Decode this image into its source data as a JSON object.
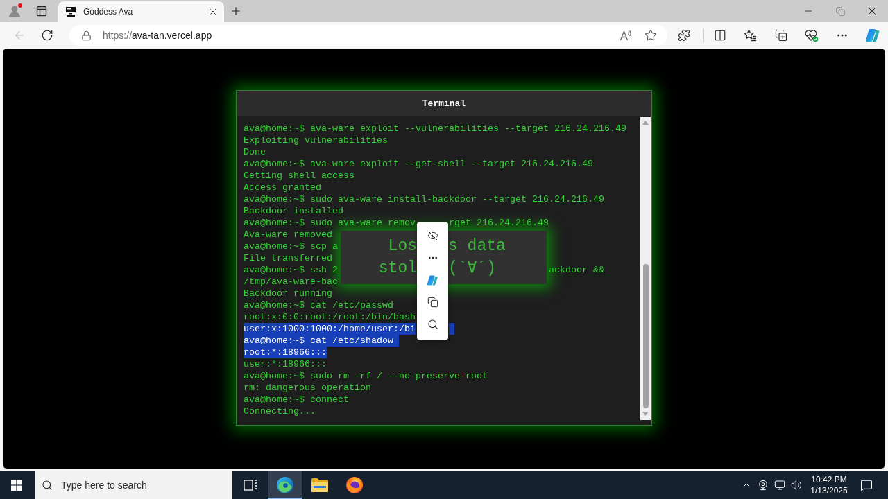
{
  "browser": {
    "tabs": [
      {
        "title": "Goddess Ava",
        "selected": true
      }
    ],
    "back_button": {
      "disabled": true
    },
    "address": {
      "scheme": "https://",
      "host": "ava-tan.vercel.app"
    }
  },
  "terminal": {
    "title": "Terminal",
    "lines": [
      {
        "segments": [
          "ava@home:~$ ava-ware exploit --vulnerabilities --target 216.24.216.49"
        ],
        "kind": "full",
        "selected": false
      },
      {
        "segments": [
          "Exploiting vulnerabilities"
        ],
        "kind": "full",
        "selected": false
      },
      {
        "segments": [
          "Done"
        ],
        "kind": "full",
        "selected": false
      },
      {
        "segments": [
          "ava@home:~$ ava-ware exploit --get-shell --target 216.24.216.49"
        ],
        "kind": "full",
        "selected": false
      },
      {
        "segments": [
          "Getting shell access"
        ],
        "kind": "full",
        "selected": false
      },
      {
        "segments": [
          "Access granted"
        ],
        "kind": "full",
        "selected": false
      },
      {
        "segments": [
          "ava@home:~$ sudo ava-ware install-backdoor --target 216.24.216.49"
        ],
        "kind": "full",
        "selected": false
      },
      {
        "segments": [
          "Backdoor installed"
        ],
        "kind": "full",
        "selected": false
      },
      {
        "segments": [
          "ava@home:~$ sudo ava-ware remov",
          "rget 216.24.216.49"
        ],
        "kind": "menuclipped",
        "selected": false
      },
      {
        "segments": [
          "Ava-ware removed"
        ],
        "kind": "full",
        "selected": false
      },
      {
        "segments": [
          "ava@home:~$ scp a"
        ],
        "kind": "full",
        "selected": false
      },
      {
        "segments": [
          "File transferred"
        ],
        "kind": "full",
        "selected": false
      },
      {
        "segments": [
          "ava@home:~$ ssh 2",
          "ackdoor &&"
        ],
        "kind": "popupclipped",
        "selected": false
      },
      {
        "segments": [
          "/tmp/ava-ware-bac"
        ],
        "kind": "full",
        "selected": false
      },
      {
        "segments": [
          "Backdoor running"
        ],
        "kind": "full",
        "selected": false
      },
      {
        "segments": [
          "ava@home:~$ cat /etc/passwd"
        ],
        "kind": "full",
        "selected": false
      },
      {
        "segments": [
          "root:x:0:0:root:/root:/bin/bash"
        ],
        "kind": "full",
        "selected": false
      },
      {
        "segments": [
          "user:x:1000:1000:/home/user:/bi"
        ],
        "kind": "menuclipped",
        "selected": true
      },
      {
        "segments": [
          "ava@home:~$ cat /etc/shadow"
        ],
        "kind": "full",
        "selected": true
      },
      {
        "segments": [
          "root:*:18966:::"
        ],
        "kind": "full",
        "selected": true
      },
      {
        "segments": [
          "user:*:18966:::"
        ],
        "kind": "full",
        "selected": false
      },
      {
        "segments": [
          "ava@home:~$ sudo rm -rf / --no-preserve-root"
        ],
        "kind": "full",
        "selected": false
      },
      {
        "segments": [
          "rm: dangerous operation"
        ],
        "kind": "full",
        "selected": false
      },
      {
        "segments": [
          "ava@home:~$ connect"
        ],
        "kind": "full",
        "selected": false
      },
      {
        "segments": [
          "Connecting..."
        ],
        "kind": "full",
        "selected": false
      }
    ]
  },
  "popup": {
    "lines": [
      [
        "Los",
        "s data"
      ],
      [
        "stol",
        "(`∀´)"
      ]
    ]
  },
  "taskbar": {
    "search": {
      "placeholder": "Type here to search"
    },
    "apps": [
      {
        "kind": "task_view",
        "active": false
      },
      {
        "kind": "browser",
        "active": true
      },
      {
        "kind": "files",
        "active": false
      },
      {
        "kind": "fox_browser",
        "active": false
      }
    ],
    "clock": {
      "time": "10:42 PM",
      "date": "1/13/2025"
    }
  }
}
